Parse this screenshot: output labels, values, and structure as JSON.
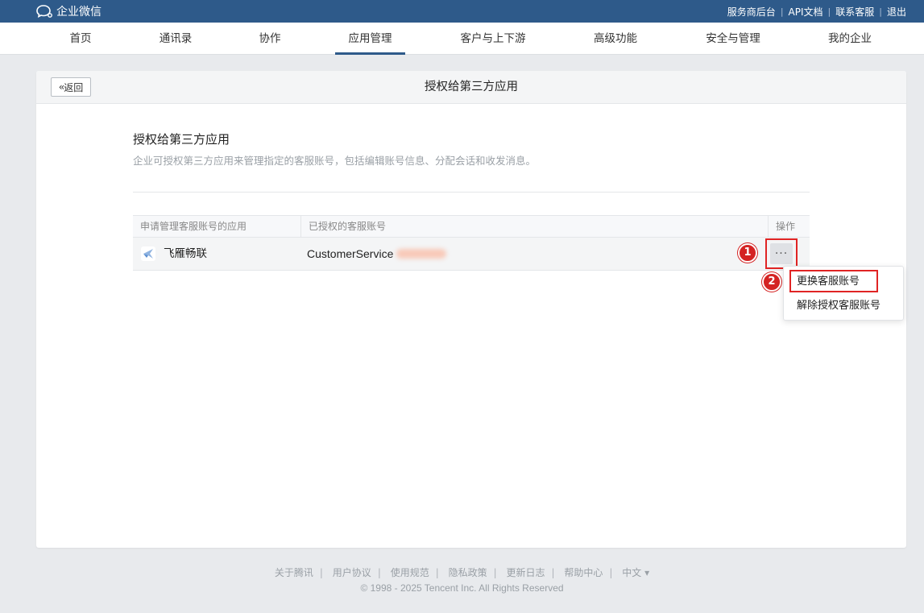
{
  "topbar": {
    "logo_text": "企业微信",
    "links": [
      "服务商后台",
      "API文档",
      "联系客服",
      "退出"
    ]
  },
  "nav": {
    "items": [
      "首页",
      "通讯录",
      "协作",
      "应用管理",
      "客户与上下游",
      "高级功能",
      "安全与管理",
      "我的企业"
    ],
    "active": "应用管理"
  },
  "card": {
    "back_label": "返回",
    "title": "授权给第三方应用"
  },
  "section": {
    "title": "授权给第三方应用",
    "description": "企业可授权第三方应用来管理指定的客服账号，包括编辑账号信息、分配会话和收发消息。"
  },
  "table": {
    "headers": [
      "申请管理客服账号的应用",
      "已授权的客服账号",
      "操作"
    ],
    "rows": [
      {
        "app": "飞雁畅联",
        "account": "CustomerService",
        "action_icon": "more-icon"
      }
    ]
  },
  "dropdown": {
    "items": [
      "更换客服账号",
      "解除授权客服账号"
    ]
  },
  "annotations": {
    "badge1": "1",
    "badge2": "2",
    "highlight_color": "#e02424"
  },
  "footer": {
    "links": [
      "关于腾讯",
      "用户协议",
      "使用规范",
      "隐私政策",
      "更新日志",
      "帮助中心",
      "中文 ▾"
    ],
    "copyright": "© 1998 - 2025 Tencent Inc. All Rights Reserved"
  },
  "colors": {
    "topbar": "#2e5a8a",
    "nav_active_underline": "#2e5a8a",
    "badge": "#d42323"
  }
}
